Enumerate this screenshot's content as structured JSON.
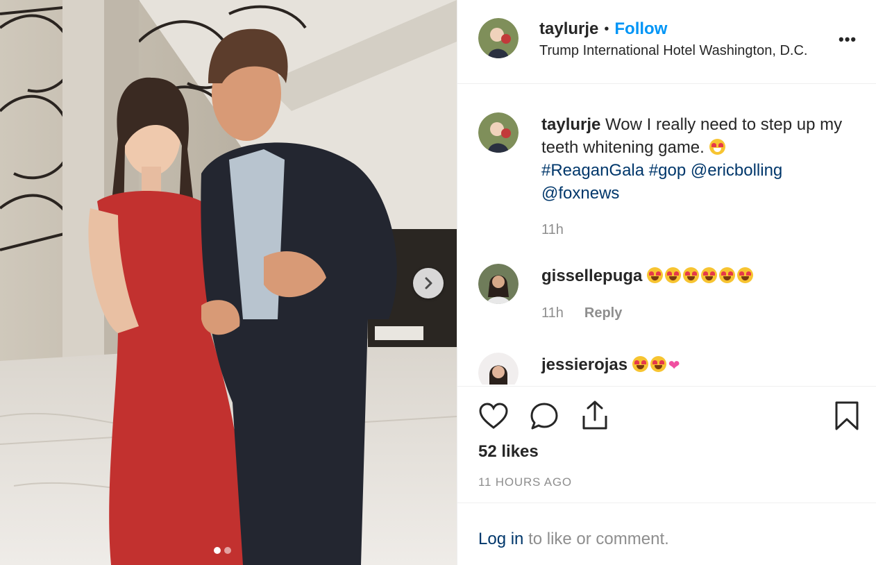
{
  "post": {
    "username": "taylurje",
    "separator": "•",
    "follow_label": "Follow",
    "location": "Trump International Hotel Washington, D.C.",
    "more_label": "•••"
  },
  "caption": {
    "username": "taylurje",
    "text": "Wow I really need to step up my teeth whitening game.",
    "tags": [
      "#ReaganGala",
      "#gop",
      "@ericbolling",
      "@foxnews"
    ],
    "time": "11h"
  },
  "comments": [
    {
      "username": "gissellepuga",
      "emoji_count": 6,
      "time": "11h",
      "reply_label": "Reply"
    },
    {
      "username": "jessierojas",
      "emoji_count": 2
    }
  ],
  "stats": {
    "likes": "52 likes",
    "timestamp": "11 HOURS AGO"
  },
  "login": {
    "link_label": "Log in",
    "rest_text": "to like or comment."
  },
  "carousel": {
    "slide_count": 2,
    "active_index": 0
  },
  "colors": {
    "accent": "#0095f6",
    "link": "#00376b",
    "muted": "#8e8e8e"
  }
}
